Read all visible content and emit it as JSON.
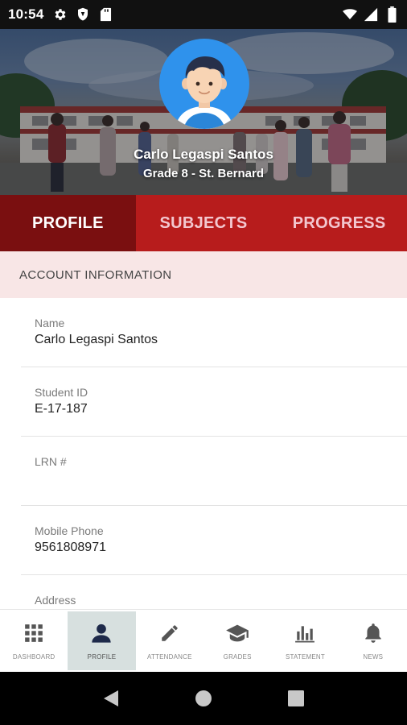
{
  "status_bar": {
    "time": "10:54",
    "left_icons": [
      "gear-icon",
      "shield-icon",
      "sd-card-icon"
    ],
    "right_icons": [
      "wifi-icon",
      "signal-icon",
      "battery-icon"
    ]
  },
  "profile": {
    "name": "Carlo Legaspi Santos",
    "grade_section": "Grade 8 - St. Bernard"
  },
  "tabs": [
    {
      "label": "PROFILE",
      "active": true
    },
    {
      "label": "SUBJECTS",
      "active": false
    },
    {
      "label": "PROGRESS",
      "active": false
    }
  ],
  "section": {
    "title": "ACCOUNT INFORMATION"
  },
  "fields": [
    {
      "label": "Name",
      "value": "Carlo Legaspi Santos"
    },
    {
      "label": "Student ID",
      "value": "E-17-187"
    },
    {
      "label": "LRN #",
      "value": ""
    },
    {
      "label": "Mobile Phone",
      "value": "9561808971"
    },
    {
      "label": "Address",
      "value": ""
    }
  ],
  "bottom_nav": [
    {
      "label": "DASHBOARD",
      "icon": "grid-icon",
      "active": false
    },
    {
      "label": "PROFILE",
      "icon": "person-icon",
      "active": true
    },
    {
      "label": "ATTENDANCE",
      "icon": "pencil-icon",
      "active": false
    },
    {
      "label": "GRADES",
      "icon": "graduation-cap-icon",
      "active": false
    },
    {
      "label": "STATEMENT",
      "icon": "bar-chart-icon",
      "active": false
    },
    {
      "label": "NEWS",
      "icon": "bell-icon",
      "active": false
    }
  ],
  "colors": {
    "tab_bar": "#b71c1c",
    "tab_active": "#7a0f10",
    "section_bg": "#f8e6e6",
    "nav_active_bg": "#d7e0df",
    "nav_icon": "#555555",
    "avatar_bg": "#2f92ec"
  }
}
